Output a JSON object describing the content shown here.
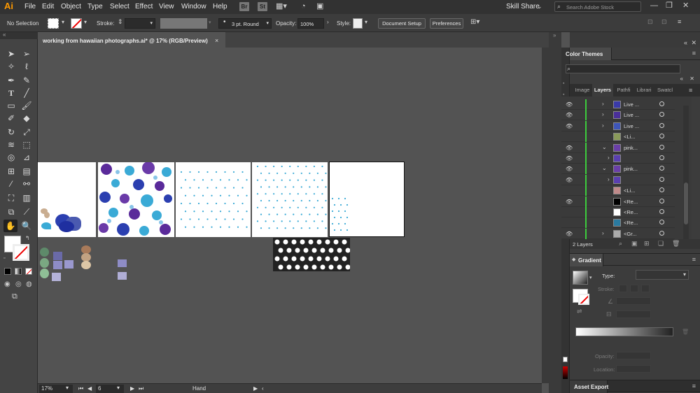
{
  "app": {
    "logo": "Ai"
  },
  "menu": {
    "items": [
      "File",
      "Edit",
      "Object",
      "Type",
      "Select",
      "Effect",
      "View",
      "Window",
      "Help"
    ]
  },
  "menu_right": {
    "bridge": "Br",
    "stock": "St",
    "workspace": "Skill Share",
    "search_placeholder": "Search Adobe Stock"
  },
  "control": {
    "selection": "No Selection",
    "stroke_label": "Stroke:",
    "brush": "3 pt. Round",
    "opacity_label": "Opacity:",
    "opacity_value": "100%",
    "style_label": "Style:",
    "doc_setup": "Document Setup",
    "preferences": "Preferences"
  },
  "document": {
    "tab_title": "working from hawaiian photographs.ai* @ 17% (RGB/Preview)",
    "close": "×"
  },
  "status": {
    "zoom": "17%",
    "artboard": "6",
    "tool": "Hand"
  },
  "color_themes": {
    "title": "Color Themes"
  },
  "layers_panel": {
    "tabs": [
      "Image",
      "Layers",
      "Pathfi",
      "Librari",
      "Swatcl"
    ],
    "active_tab": "Layers",
    "rows": [
      {
        "name": "Live ...",
        "visible": true,
        "expandable": true,
        "thumb": "#3a3aa8"
      },
      {
        "name": "Live ...",
        "visible": true,
        "expandable": true,
        "thumb": "#4a2f9a"
      },
      {
        "name": "Live ...",
        "visible": true,
        "expandable": true,
        "thumb": "#3e56b8"
      },
      {
        "name": "<Li...",
        "visible": false,
        "expandable": false,
        "thumb": "#8a9a5a"
      },
      {
        "name": "pink...",
        "visible": true,
        "expandable": true,
        "expanded": true,
        "thumb": "#6a3fa8"
      },
      {
        "name": "",
        "visible": true,
        "expandable": true,
        "thumb": "#5a3fb0"
      },
      {
        "name": "pink...",
        "visible": true,
        "expandable": true,
        "expanded": true,
        "thumb": "#6a3fa8"
      },
      {
        "name": "",
        "visible": true,
        "expandable": true,
        "thumb": "#5a3fb0"
      },
      {
        "name": "<Li...",
        "visible": false,
        "expandable": false,
        "thumb": "#c08a8a"
      },
      {
        "name": "<Re...",
        "visible": true,
        "expandable": false,
        "thumb": "#000000"
      },
      {
        "name": "<Re...",
        "visible": false,
        "expandable": false,
        "thumb": "#ffffff"
      },
      {
        "name": "<Re...",
        "visible": false,
        "expandable": false,
        "thumb": "#2a7aa0"
      },
      {
        "name": "<Gr...",
        "visible": true,
        "expandable": true,
        "thumb": "#aaaaaa"
      }
    ],
    "layer_count": "2 Layers"
  },
  "gradient": {
    "title": "Gradient",
    "type_label": "Type:",
    "stroke_label": "Stroke:",
    "opacity_label": "Opacity:",
    "location_label": "Location:"
  },
  "asset_export": {
    "title": "Asset Export"
  },
  "colors": {
    "purple": "#5a2a9a",
    "blue": "#2b3fb0",
    "cyan": "#3aaad6",
    "swatch_green": "#7aa882",
    "swatch_lavender": "#8e8cc6",
    "swatch_tan": "#c2a282",
    "layer_green": "#3dcc3d"
  },
  "icons": [
    "selection-tool-icon",
    "direct-selection-tool-icon",
    "pen-tool-icon",
    "type-tool-icon",
    "hand-tool-icon",
    "zoom-tool-icon",
    "eye-icon",
    "panel-menu-icon",
    "search-icon"
  ]
}
